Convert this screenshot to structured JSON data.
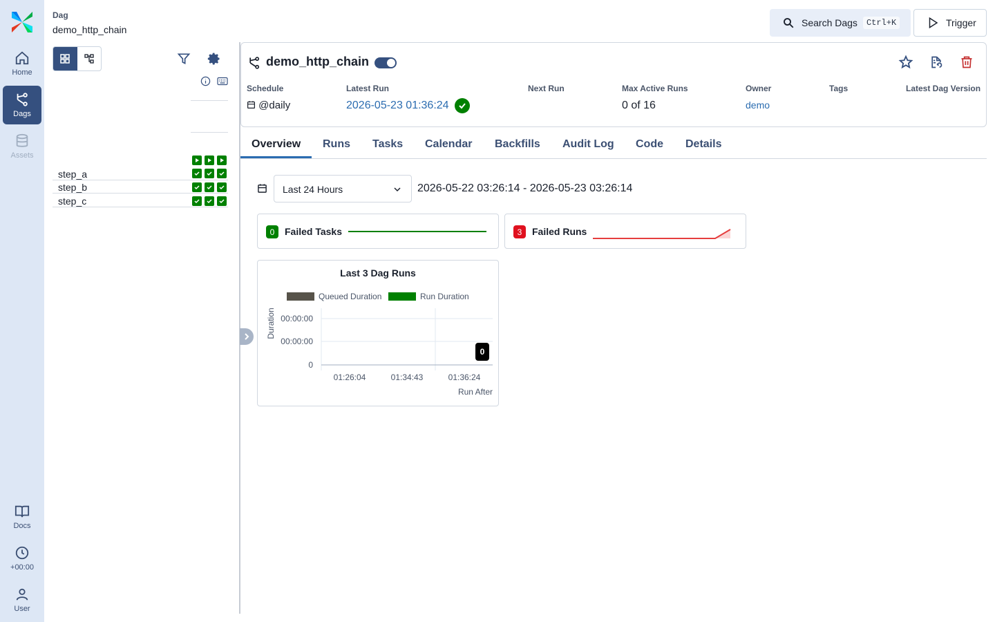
{
  "nav": {
    "items": [
      {
        "label": "Home",
        "icon": "home-icon"
      },
      {
        "label": "Dags",
        "icon": "dags-icon"
      },
      {
        "label": "Assets",
        "icon": "database-icon"
      }
    ],
    "bottom": [
      {
        "label": "Docs",
        "icon": "book-icon"
      },
      {
        "label": "+00:00",
        "icon": "clock-icon"
      },
      {
        "label": "User",
        "icon": "user-icon"
      }
    ]
  },
  "breadcrumb": {
    "label": "Dag",
    "value": "demo_http_chain"
  },
  "header": {
    "search_label": "Search Dags",
    "search_shortcut": "Ctrl+K",
    "trigger_label": "Trigger"
  },
  "grid": {
    "tasks": [
      {
        "name": "step_a",
        "states": [
          "success",
          "success",
          "success"
        ]
      },
      {
        "name": "step_b",
        "states": [
          "success",
          "success",
          "success"
        ]
      },
      {
        "name": "step_c",
        "states": [
          "success",
          "success",
          "success"
        ]
      }
    ],
    "run_states": [
      "running",
      "running",
      "running"
    ]
  },
  "dag": {
    "title": "demo_http_chain",
    "paused": false,
    "meta": {
      "schedule_label": "Schedule",
      "schedule_value": "@daily",
      "latest_run_label": "Latest Run",
      "latest_run_value": "2026-05-23 01:36:24",
      "next_run_label": "Next Run",
      "next_run_value": "",
      "max_active_label": "Max Active Runs",
      "max_active_value": "0 of 16",
      "owner_label": "Owner",
      "owner_value": "demo",
      "tags_label": "Tags",
      "version_label": "Latest Dag Version"
    }
  },
  "tabs": [
    "Overview",
    "Runs",
    "Tasks",
    "Calendar",
    "Backfills",
    "Audit Log",
    "Code",
    "Details"
  ],
  "overview": {
    "range_select": "Last 24 Hours",
    "range_text": "2026-05-22 03:26:14 - 2026-05-23 03:26:14",
    "failed_tasks": {
      "count": "0",
      "label": "Failed Tasks"
    },
    "failed_runs": {
      "count": "3",
      "label": "Failed Runs"
    }
  },
  "chart_data": {
    "type": "bar",
    "title": "Last 3 Dag Runs",
    "xlabel": "Run After",
    "ylabel": "Duration",
    "categories": [
      "01:26:04",
      "01:34:43",
      "01:36:24"
    ],
    "yticks": [
      "0",
      "00:00:00",
      "00:00:00"
    ],
    "series": [
      {
        "name": "Queued Duration",
        "values": [
          0,
          0,
          0
        ]
      },
      {
        "name": "Run Duration",
        "values": [
          0,
          0,
          0
        ]
      }
    ],
    "tooltip": "0",
    "colors": {
      "queued": "#57534a",
      "run": "#008000"
    }
  }
}
